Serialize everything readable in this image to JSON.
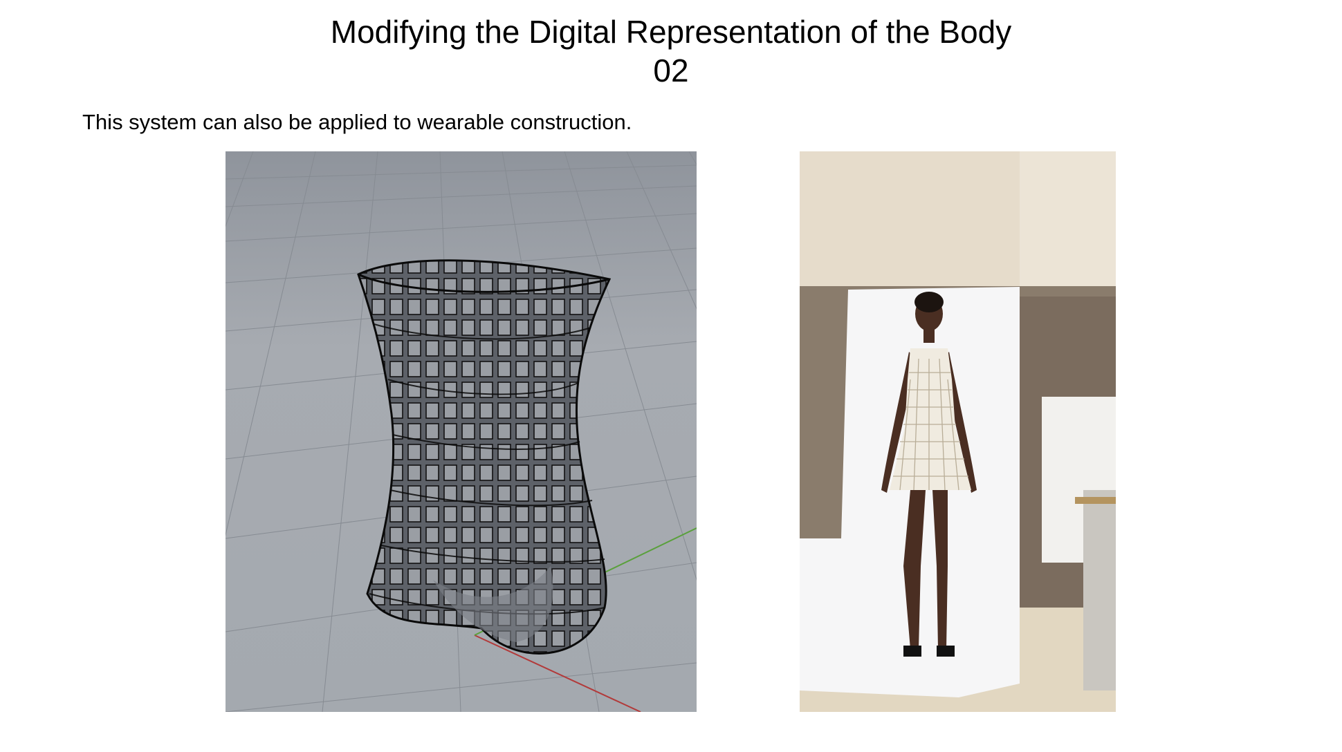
{
  "slide": {
    "title_line1": "Modifying the Digital Representation of the Body",
    "title_line2": "02",
    "body": "This system can also be applied to wearable construction."
  },
  "figures": [
    {
      "content": "3D wireframe model of a wearable form"
    },
    {
      "content": "Photograph of a model wearing a constructed dress"
    }
  ],
  "colors": {
    "background": "#ffffff",
    "viewport_grey": "#a3a8ae",
    "axis_red": "#b23a3a",
    "axis_green": "#5aa03c",
    "wall": "#e9dfcf",
    "backdrop": "#f5f5f6",
    "dress": "#f0ebe0"
  }
}
